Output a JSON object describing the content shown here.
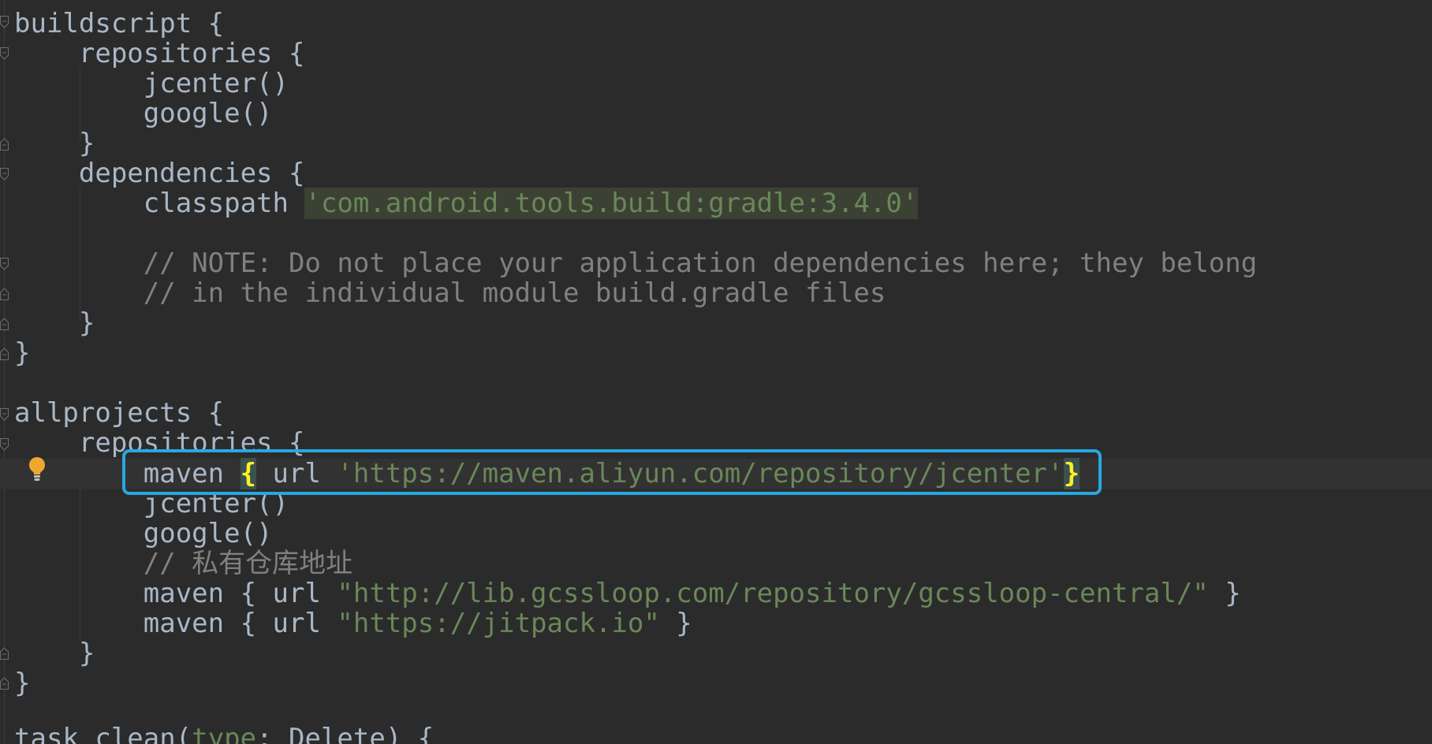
{
  "editor": {
    "lines": [
      {
        "text": "buildscript {"
      },
      {
        "text": "    repositories {"
      },
      {
        "text": "        jcenter()"
      },
      {
        "text": "        google()"
      },
      {
        "text": "    }"
      },
      {
        "text": "    dependencies {"
      },
      {
        "prefix": "        classpath ",
        "string": "'com.android.tools.build:gradle:3.4.0'"
      },
      {
        "text": ""
      },
      {
        "comment": "        // NOTE: Do not place your application dependencies here; they belong"
      },
      {
        "comment": "        // in the individual module build.gradle files"
      },
      {
        "text": "    }"
      },
      {
        "text": "}"
      },
      {
        "text": ""
      },
      {
        "text": "allprojects {"
      },
      {
        "text": "    repositories {"
      },
      {
        "prefix": "        maven ",
        "open_brace": "{",
        "mid": " url ",
        "string": "'https://maven.aliyun.com/repository/jcenter'",
        "close_brace": "}"
      },
      {
        "text": "        jcenter()"
      },
      {
        "text": "        google()"
      },
      {
        "comment": "        // 私有仓库地址"
      },
      {
        "prefix": "        maven { url ",
        "string": "\"http://lib.gcssloop.com/repository/gcssloop-central/\"",
        "suffix": " }"
      },
      {
        "prefix": "        maven { url ",
        "string": "\"https://jitpack.io\"",
        "suffix": " }"
      },
      {
        "text": "    }"
      },
      {
        "text": "}"
      },
      {
        "text": ""
      },
      {
        "prefix": "task clean(",
        "param": "type",
        "suffix": ": Delete) {"
      }
    ]
  },
  "colors": {
    "background": "#2b2b2b",
    "string": "#6a8759",
    "comment": "#808080",
    "default_text": "#a9b7c6",
    "highlight_box": "#28a8e0",
    "matched_brace": "#ffef28"
  },
  "icons": {
    "intention_bulb": "lightbulb-icon",
    "fold_marker": "fold-marker-icon"
  }
}
